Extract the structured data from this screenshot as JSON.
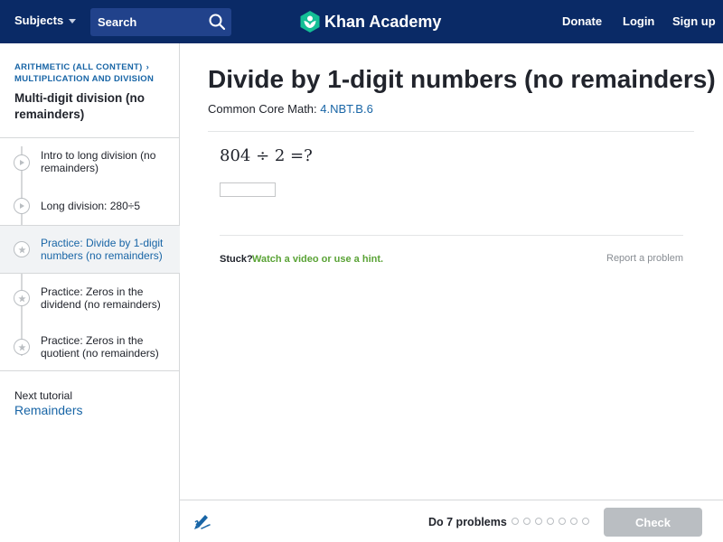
{
  "header": {
    "subjects_label": "Subjects",
    "search_label": "Search",
    "logo_text": "Khan Academy",
    "donate": "Donate",
    "login": "Login",
    "signup": "Sign up"
  },
  "sidebar": {
    "breadcrumb_parent": "ARITHMETIC (ALL CONTENT)",
    "breadcrumb_current": "MULTIPLICATION AND DIVISION",
    "unit_title": "Multi-digit division (no remainders)",
    "items": [
      {
        "label": "Intro to long division (no remainders)",
        "icon": "play-icon",
        "active": false
      },
      {
        "label": "Long division: 280÷5",
        "icon": "play-icon",
        "active": false
      },
      {
        "label": "Practice: Divide by 1-digit numbers (no remainders)",
        "icon": "star-icon",
        "active": true
      },
      {
        "label": "Practice: Zeros in the dividend (no remainders)",
        "icon": "star-icon",
        "active": false
      },
      {
        "label": "Practice: Zeros in the quotient (no remainders)",
        "icon": "star-icon",
        "active": false
      }
    ],
    "next_label": "Next tutorial",
    "next_link": "Remainders"
  },
  "main": {
    "title": "Divide by 1-digit numbers (no remainders)",
    "standard_prefix": "Common Core Math:",
    "standard_code": "4.NBT.B.6",
    "problem": "804 ÷ 2 =?",
    "answer_value": "",
    "stuck_label": "Stuck?",
    "stuck_link": "Watch a video or use a hint.",
    "report_link": "Report a problem"
  },
  "footer": {
    "do_label": "Do 7 problems",
    "problem_count": 7,
    "completed": 0,
    "check_label": "Check"
  },
  "colors": {
    "header_bg": "#0a2a66",
    "search_bg": "#21428b",
    "link_blue": "#1865a6",
    "hint_green": "#5aa336",
    "logo_green": "#14bf96",
    "disabled_gray": "#babec2"
  }
}
